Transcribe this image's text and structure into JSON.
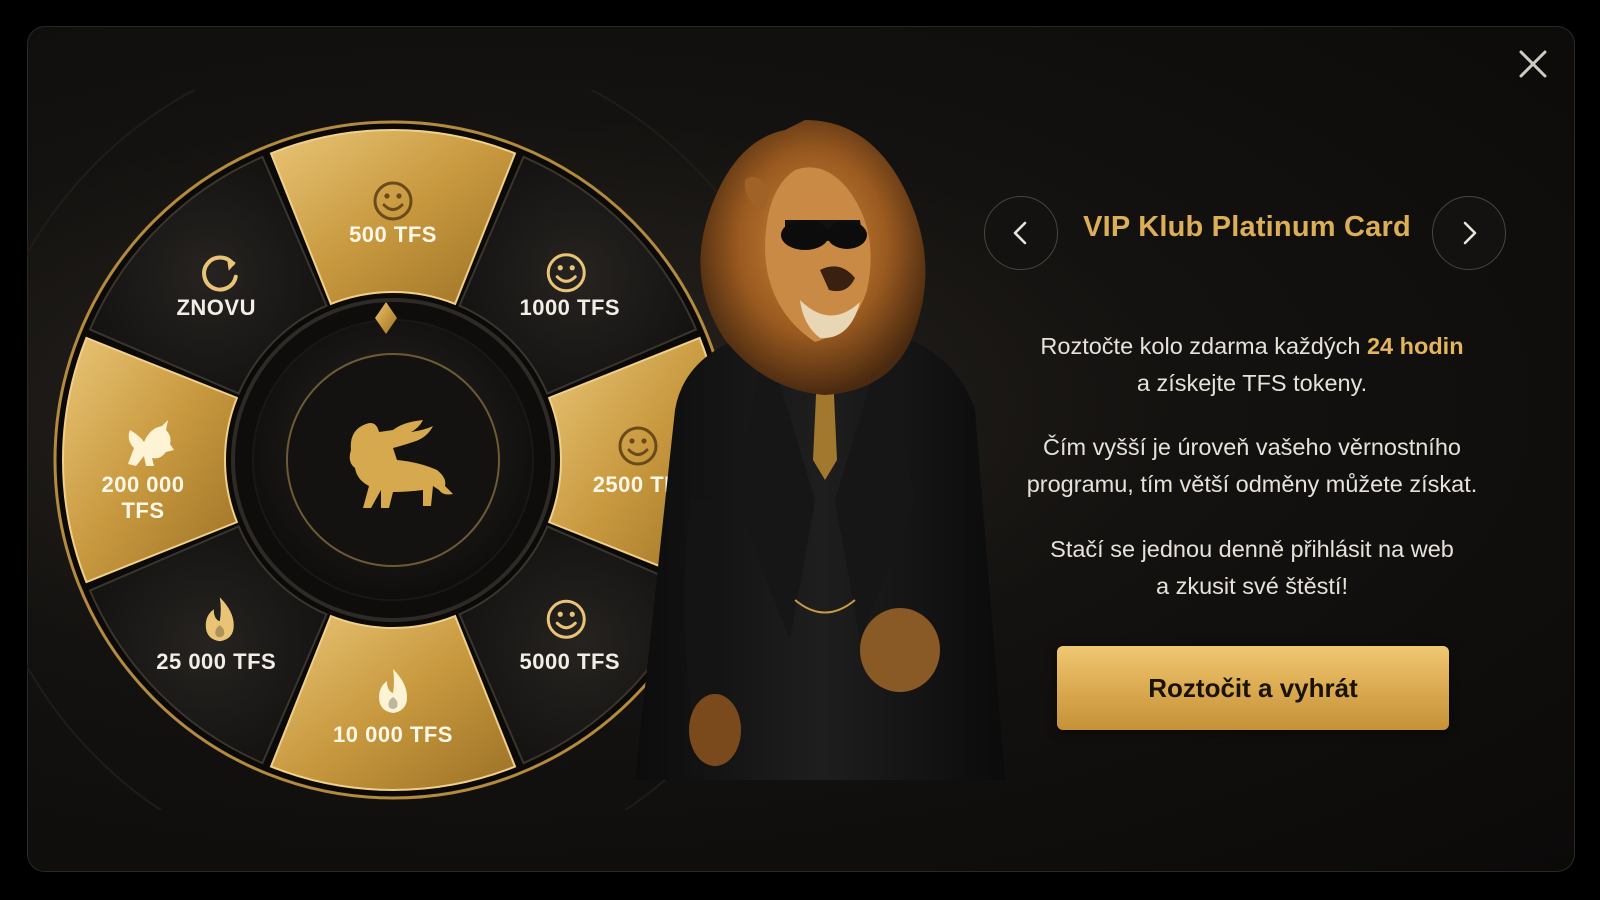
{
  "modal": {
    "close_icon": "close-icon"
  },
  "wheel": {
    "center_icon": "winged-lion-icon",
    "segments": [
      {
        "label": "500 TFS",
        "icon": "smiley-icon",
        "style": "gold"
      },
      {
        "label": "1000 TFS",
        "icon": "smiley-icon",
        "style": "dark"
      },
      {
        "label": "2500 TFS",
        "icon": "smiley-icon",
        "style": "gold"
      },
      {
        "label": "5000 TFS",
        "icon": "smiley-icon",
        "style": "dark"
      },
      {
        "label": "10 000 TFS",
        "icon": "flame-icon",
        "style": "gold"
      },
      {
        "label": "25 000 TFS",
        "icon": "flame-icon",
        "style": "dark"
      },
      {
        "label_line1": "200 000",
        "label_line2": "TFS",
        "icon": "unicorn-icon",
        "style": "gold"
      },
      {
        "label": "ZNOVU",
        "icon": "refresh-icon",
        "style": "dark"
      }
    ]
  },
  "card": {
    "title": "VIP Klub Platinum Card",
    "prev_icon": "chevron-left-icon",
    "next_icon": "chevron-right-icon"
  },
  "description": {
    "p1_before": "Roztočte kolo zdarma každých ",
    "p1_highlight": "24 hodin",
    "p1_after": "a získejte TFS tokeny.",
    "p2_line1": "Čím vyšší je úroveň vašeho věrnostního",
    "p2_line2": "programu, tím větší odměny můžete získat.",
    "p3_line1": "Stačí se jednou denně přihlásit na web",
    "p3_line2": "a zkusit své štěstí!"
  },
  "spin_button": {
    "label": "Roztočit a vyhrát"
  },
  "colors": {
    "gold": "#d9a84e",
    "highlight": "#e4b55a",
    "background": "#000000"
  }
}
